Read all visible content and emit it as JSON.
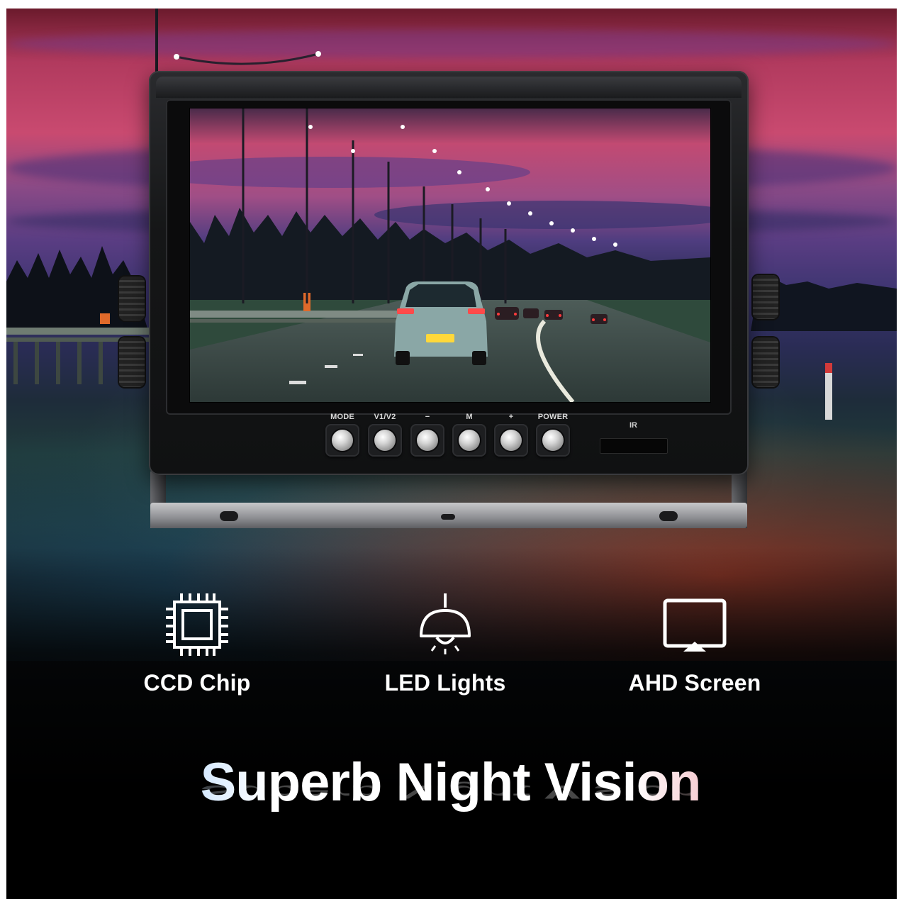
{
  "monitor": {
    "buttons": [
      {
        "label": "MODE"
      },
      {
        "label": "V1/V2"
      },
      {
        "label": "−"
      },
      {
        "label": "M"
      },
      {
        "label": "+"
      },
      {
        "label": "POWER"
      }
    ],
    "ir_label": "IR"
  },
  "features": [
    {
      "label": "CCD Chip",
      "icon": "chip-icon"
    },
    {
      "label": "LED Lights",
      "icon": "lamp-icon"
    },
    {
      "label": "AHD Screen",
      "icon": "screen-icon"
    }
  ],
  "headline": "Superb Night Vision",
  "colors": {
    "sky_pink": "#c94a70",
    "sky_purple": "#5a3d83",
    "headline_blue": "#5aa8ff",
    "headline_red": "#d94a5a"
  }
}
